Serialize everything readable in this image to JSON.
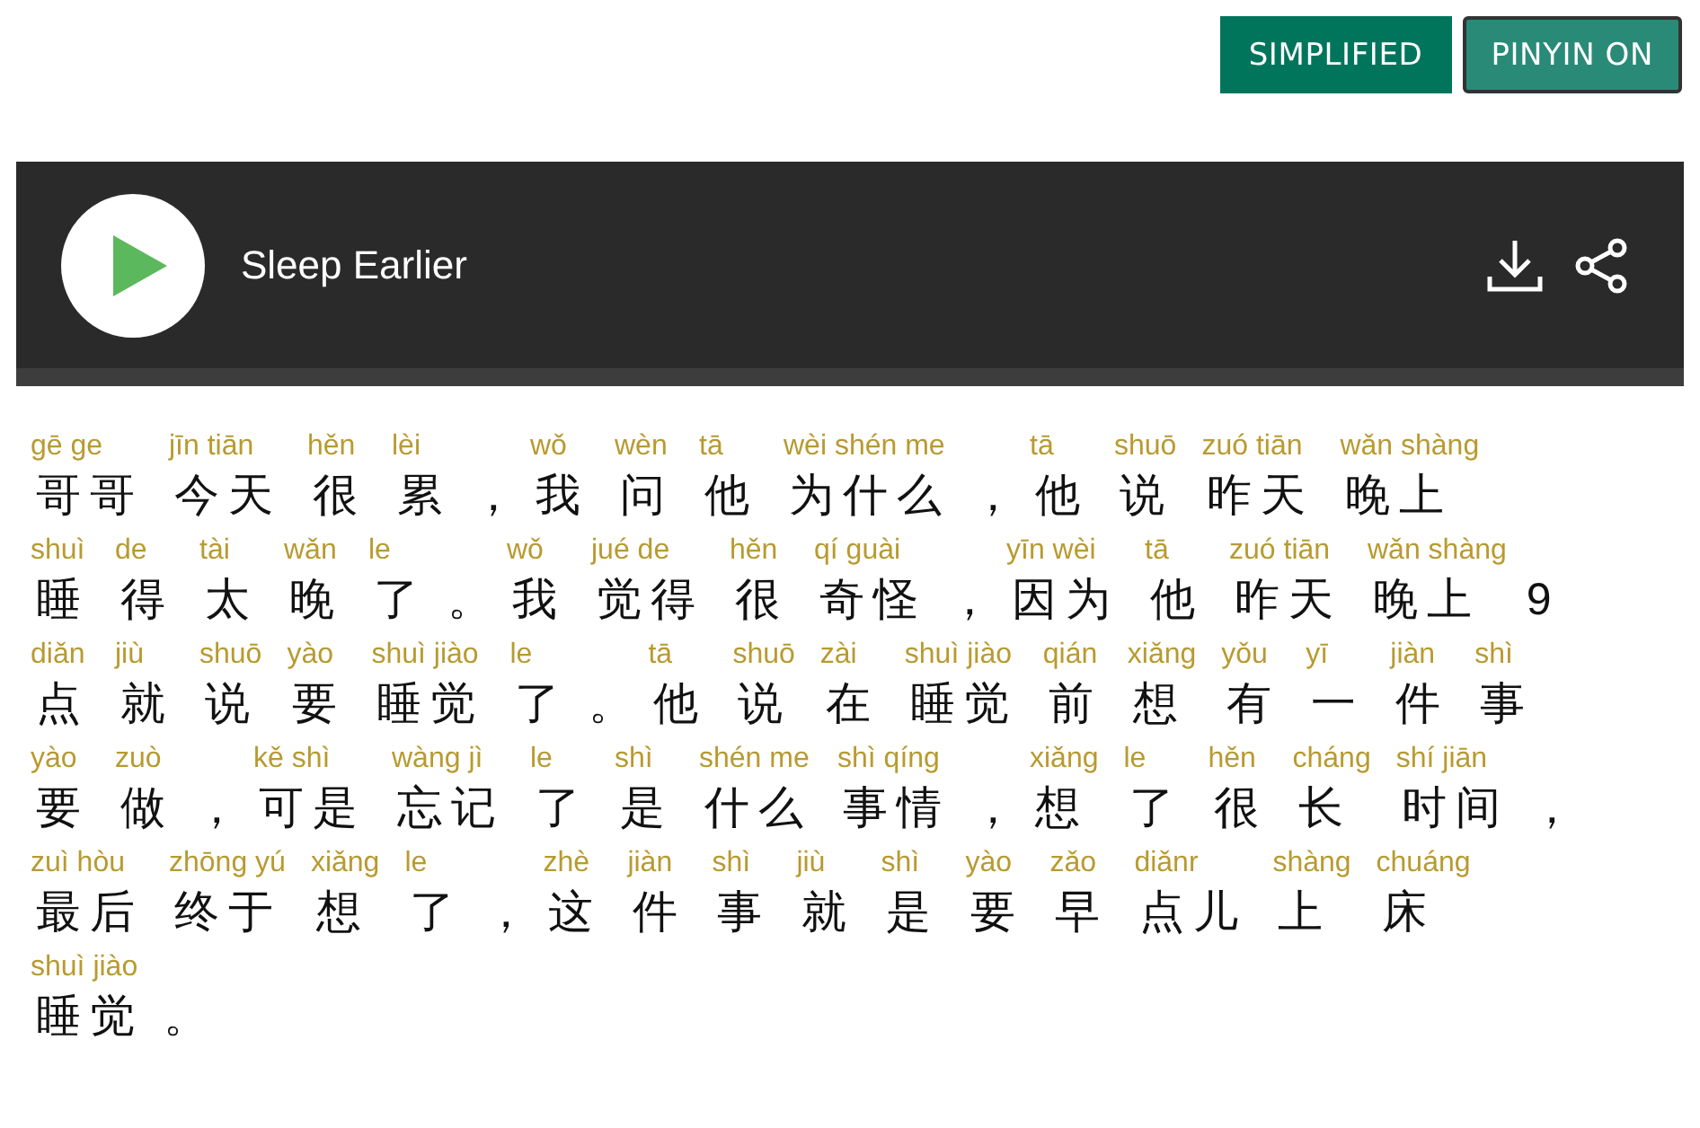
{
  "toggles": [
    {
      "label": "SIMPLIFIED",
      "focused": false
    },
    {
      "label": "PINYIN ON",
      "focused": true
    }
  ],
  "player": {
    "title": "Sleep Earlier"
  },
  "lines": [
    {
      "words": [
        {
          "pinyin": "gē ge",
          "hanzi": "哥哥"
        },
        {
          "pinyin": "jīn tiān",
          "hanzi": "今天"
        },
        {
          "pinyin": "hěn",
          "hanzi": "很"
        },
        {
          "pinyin": "lèi",
          "hanzi": "累"
        },
        {
          "hanzi": "，"
        },
        {
          "pinyin": "wǒ",
          "hanzi": "我"
        },
        {
          "pinyin": "wèn",
          "hanzi": "问"
        },
        {
          "pinyin": "tā",
          "hanzi": "他"
        },
        {
          "pinyin": "wèi shén me",
          "hanzi": "为什么"
        },
        {
          "hanzi": "，"
        },
        {
          "pinyin": "tā",
          "hanzi": "他"
        },
        {
          "pinyin": "shuō",
          "hanzi": "说"
        },
        {
          "pinyin": "zuó tiān",
          "hanzi": "昨天"
        },
        {
          "pinyin": "wǎn shàng",
          "hanzi": "晚上"
        }
      ]
    },
    {
      "words": [
        {
          "pinyin": "shuì",
          "hanzi": "睡"
        },
        {
          "pinyin": "de",
          "hanzi": "得"
        },
        {
          "pinyin": "tài",
          "hanzi": "太"
        },
        {
          "pinyin": "wǎn",
          "hanzi": "晚"
        },
        {
          "pinyin": "le",
          "hanzi": "了"
        },
        {
          "hanzi": "。"
        },
        {
          "pinyin": "wǒ",
          "hanzi": "我"
        },
        {
          "pinyin": "jué de",
          "hanzi": "觉得"
        },
        {
          "pinyin": "hěn",
          "hanzi": "很"
        },
        {
          "pinyin": "qí guài",
          "hanzi": "奇怪"
        },
        {
          "hanzi": "，"
        },
        {
          "pinyin": "yīn wèi",
          "hanzi": "因为"
        },
        {
          "pinyin": "tā",
          "hanzi": "他"
        },
        {
          "pinyin": "zuó tiān",
          "hanzi": "昨天"
        },
        {
          "pinyin": "wǎn shàng",
          "hanzi": "晚上"
        },
        {
          "hanzi": "9"
        }
      ]
    },
    {
      "words": [
        {
          "pinyin": "diǎn",
          "hanzi": "点"
        },
        {
          "pinyin": "jiù",
          "hanzi": "就"
        },
        {
          "pinyin": "shuō",
          "hanzi": "说"
        },
        {
          "pinyin": "yào",
          "hanzi": "要"
        },
        {
          "pinyin": "shuì jiào",
          "hanzi": "睡觉"
        },
        {
          "pinyin": "le",
          "hanzi": "了"
        },
        {
          "hanzi": "。"
        },
        {
          "pinyin": "tā",
          "hanzi": "他"
        },
        {
          "pinyin": "shuō",
          "hanzi": "说"
        },
        {
          "pinyin": "zài",
          "hanzi": "在"
        },
        {
          "pinyin": "shuì jiào",
          "hanzi": "睡觉"
        },
        {
          "pinyin": "qián",
          "hanzi": "前"
        },
        {
          "pinyin": "xiǎng",
          "hanzi": "想"
        },
        {
          "pinyin": "yǒu",
          "hanzi": "有"
        },
        {
          "pinyin": "yī",
          "hanzi": "一"
        },
        {
          "pinyin": "jiàn",
          "hanzi": "件"
        },
        {
          "pinyin": "shì",
          "hanzi": "事"
        }
      ]
    },
    {
      "words": [
        {
          "pinyin": "yào",
          "hanzi": "要"
        },
        {
          "pinyin": "zuò",
          "hanzi": "做"
        },
        {
          "hanzi": "，"
        },
        {
          "pinyin": "kě shì",
          "hanzi": "可是"
        },
        {
          "pinyin": "wàng jì",
          "hanzi": "忘记"
        },
        {
          "pinyin": "le",
          "hanzi": "了"
        },
        {
          "pinyin": "shì",
          "hanzi": "是"
        },
        {
          "pinyin": "shén me",
          "hanzi": "什么"
        },
        {
          "pinyin": "shì qíng",
          "hanzi": "事情"
        },
        {
          "hanzi": "，"
        },
        {
          "pinyin": "xiǎng",
          "hanzi": "想"
        },
        {
          "pinyin": "le",
          "hanzi": "了"
        },
        {
          "pinyin": "hěn",
          "hanzi": "很"
        },
        {
          "pinyin": "cháng",
          "hanzi": "长"
        },
        {
          "pinyin": "shí jiān",
          "hanzi": "时间"
        },
        {
          "hanzi": "，"
        }
      ]
    },
    {
      "words": [
        {
          "pinyin": "zuì hòu",
          "hanzi": "最后"
        },
        {
          "pinyin": "zhōng yú",
          "hanzi": "终于"
        },
        {
          "pinyin": "xiǎng",
          "hanzi": "想"
        },
        {
          "pinyin": "le",
          "hanzi": "了"
        },
        {
          "hanzi": "，"
        },
        {
          "pinyin": "zhè",
          "hanzi": "这"
        },
        {
          "pinyin": "jiàn",
          "hanzi": "件"
        },
        {
          "pinyin": "shì",
          "hanzi": "事"
        },
        {
          "pinyin": "jiù",
          "hanzi": "就"
        },
        {
          "pinyin": "shì",
          "hanzi": "是"
        },
        {
          "pinyin": "yào",
          "hanzi": "要"
        },
        {
          "pinyin": "zǎo",
          "hanzi": "早"
        },
        {
          "pinyin": "diǎnr",
          "hanzi": "点儿"
        },
        {
          "pinyin": "shàng",
          "hanzi": "上"
        },
        {
          "pinyin": "chuáng",
          "hanzi": "床"
        }
      ]
    },
    {
      "words": [
        {
          "pinyin": "shuì jiào",
          "hanzi": "睡觉"
        },
        {
          "hanzi": "。"
        }
      ]
    }
  ]
}
